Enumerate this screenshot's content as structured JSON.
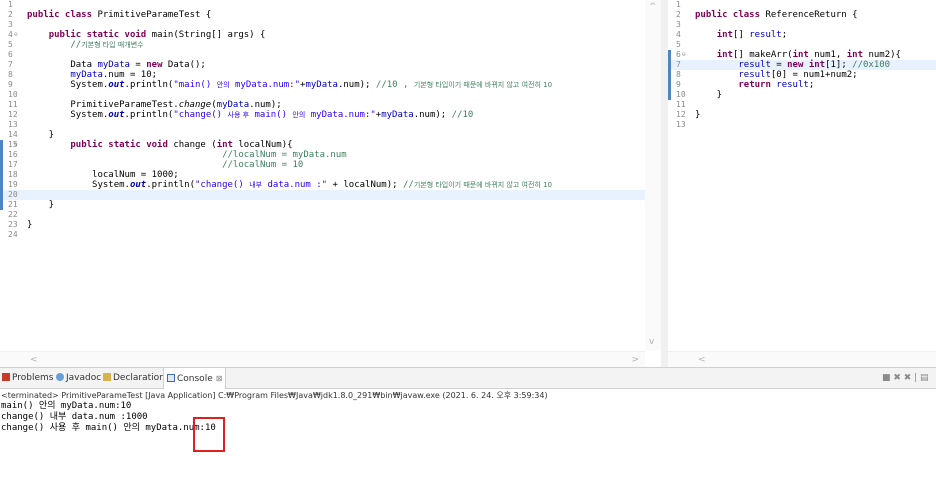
{
  "left_editor": {
    "lines": [
      {
        "n": "1",
        "ann": "",
        "parts": []
      },
      {
        "n": "2",
        "ann": "",
        "parts": [
          {
            "t": "public class",
            "c": "kw"
          },
          {
            "t": " PrimitiveParameTest {",
            "c": ""
          }
        ]
      },
      {
        "n": "3",
        "ann": "",
        "parts": []
      },
      {
        "n": "4",
        "ann": "⊖",
        "parts": [
          {
            "t": "    ",
            "c": ""
          },
          {
            "t": "public static void",
            "c": "kw"
          },
          {
            "t": " main(String[] args) {",
            "c": ""
          }
        ]
      },
      {
        "n": "5",
        "ann": "",
        "parts": [
          {
            "t": "        //",
            "c": "cmt"
          },
          {
            "t": "기본형 타입 매개변수",
            "c": "cmt kr"
          }
        ]
      },
      {
        "n": "6",
        "ann": "",
        "parts": []
      },
      {
        "n": "7",
        "ann": "",
        "parts": [
          {
            "t": "        Data ",
            "c": ""
          },
          {
            "t": "myData",
            "c": "fld"
          },
          {
            "t": " = ",
            "c": ""
          },
          {
            "t": "new",
            "c": "kw"
          },
          {
            "t": " Data();",
            "c": ""
          }
        ]
      },
      {
        "n": "8",
        "ann": "",
        "parts": [
          {
            "t": "        ",
            "c": ""
          },
          {
            "t": "myData",
            "c": "fld"
          },
          {
            "t": ".num = 10;",
            "c": ""
          }
        ]
      },
      {
        "n": "9",
        "ann": "",
        "parts": [
          {
            "t": "        System.",
            "c": ""
          },
          {
            "t": "out",
            "c": "st"
          },
          {
            "t": ".println(",
            "c": ""
          },
          {
            "t": "\"main() ",
            "c": "str"
          },
          {
            "t": "안의",
            "c": "str kr"
          },
          {
            "t": " myData.num:\"",
            "c": "str"
          },
          {
            "t": "+",
            "c": ""
          },
          {
            "t": "myData",
            "c": "fld"
          },
          {
            "t": ".num); ",
            "c": ""
          },
          {
            "t": "//10 , ",
            "c": "cmt"
          },
          {
            "t": "기본형 타입이기 때문에 바뀌지 않고 여전히 10",
            "c": "cmt kr"
          }
        ]
      },
      {
        "n": "10",
        "ann": "",
        "parts": []
      },
      {
        "n": "11",
        "ann": "",
        "parts": [
          {
            "t": "        PrimitiveParameTest.",
            "c": ""
          },
          {
            "t": "change",
            "c": "ital"
          },
          {
            "t": "(",
            "c": ""
          },
          {
            "t": "myData",
            "c": "fld"
          },
          {
            "t": ".num);",
            "c": ""
          }
        ]
      },
      {
        "n": "12",
        "ann": "",
        "parts": [
          {
            "t": "        System.",
            "c": ""
          },
          {
            "t": "out",
            "c": "st"
          },
          {
            "t": ".println(",
            "c": ""
          },
          {
            "t": "\"change() ",
            "c": "str"
          },
          {
            "t": "사용 후",
            "c": "str kr"
          },
          {
            "t": " main() ",
            "c": "str"
          },
          {
            "t": "안의",
            "c": "str kr"
          },
          {
            "t": " myData.num:\"",
            "c": "str"
          },
          {
            "t": "+",
            "c": ""
          },
          {
            "t": "myData",
            "c": "fld"
          },
          {
            "t": ".num); ",
            "c": ""
          },
          {
            "t": "//10",
            "c": "cmt"
          }
        ]
      },
      {
        "n": "13",
        "ann": "",
        "parts": []
      },
      {
        "n": "14",
        "ann": "",
        "parts": [
          {
            "t": "    }",
            "c": ""
          }
        ]
      },
      {
        "n": "15",
        "ann": "⊖",
        "marker": true,
        "parts": [
          {
            "t": "        ",
            "c": ""
          },
          {
            "t": "public static void",
            "c": "kw"
          },
          {
            "t": " change (",
            "c": ""
          },
          {
            "t": "int",
            "c": "kw"
          },
          {
            "t": " localNum){",
            "c": ""
          }
        ]
      },
      {
        "n": "16",
        "ann": "",
        "marker": true,
        "parts": [
          {
            "t": "                                    //localNum = myData.num",
            "c": "cmt"
          }
        ]
      },
      {
        "n": "17",
        "ann": "",
        "marker": true,
        "parts": [
          {
            "t": "                                    //localNum = 10",
            "c": "cmt"
          }
        ]
      },
      {
        "n": "18",
        "ann": "",
        "marker": true,
        "parts": [
          {
            "t": "            localNum = 1000;",
            "c": ""
          }
        ]
      },
      {
        "n": "19",
        "ann": "",
        "marker": true,
        "parts": [
          {
            "t": "            System.",
            "c": ""
          },
          {
            "t": "out",
            "c": "st"
          },
          {
            "t": ".println(",
            "c": ""
          },
          {
            "t": "\"change() ",
            "c": "str"
          },
          {
            "t": "내부",
            "c": "str kr"
          },
          {
            "t": " data.num :\"",
            "c": "str"
          },
          {
            "t": " + localNum); ",
            "c": ""
          },
          {
            "t": "//",
            "c": "cmt"
          },
          {
            "t": "기본형 타입이기 때문에 바뀌지 않고 여전히 10",
            "c": "cmt kr"
          }
        ]
      },
      {
        "n": "20",
        "ann": "",
        "marker": true,
        "current": true,
        "parts": []
      },
      {
        "n": "21",
        "ann": "",
        "marker": true,
        "parts": [
          {
            "t": "    }",
            "c": ""
          }
        ]
      },
      {
        "n": "22",
        "ann": "",
        "parts": []
      },
      {
        "n": "23",
        "ann": "",
        "parts": [
          {
            "t": "}",
            "c": ""
          }
        ]
      },
      {
        "n": "24",
        "ann": "",
        "parts": []
      }
    ]
  },
  "right_editor": {
    "lines": [
      {
        "n": "1",
        "ann": "",
        "parts": []
      },
      {
        "n": "2",
        "ann": "",
        "parts": [
          {
            "t": "public class",
            "c": "kw"
          },
          {
            "t": " ReferenceReturn {",
            "c": ""
          }
        ]
      },
      {
        "n": "3",
        "ann": "",
        "parts": []
      },
      {
        "n": "4",
        "ann": "",
        "parts": [
          {
            "t": "    ",
            "c": ""
          },
          {
            "t": "int",
            "c": "kw"
          },
          {
            "t": "[] ",
            "c": ""
          },
          {
            "t": "result",
            "c": "fld"
          },
          {
            "t": ";",
            "c": ""
          }
        ]
      },
      {
        "n": "5",
        "ann": "",
        "parts": []
      },
      {
        "n": "6",
        "ann": "⊖",
        "marker": true,
        "parts": [
          {
            "t": "    ",
            "c": ""
          },
          {
            "t": "int",
            "c": "kw"
          },
          {
            "t": "[] makeArr(",
            "c": ""
          },
          {
            "t": "int",
            "c": "kw"
          },
          {
            "t": " num1, ",
            "c": ""
          },
          {
            "t": "int",
            "c": "kw"
          },
          {
            "t": " num2){",
            "c": ""
          }
        ]
      },
      {
        "n": "7",
        "ann": "",
        "marker": true,
        "current": true,
        "parts": [
          {
            "t": "        ",
            "c": ""
          },
          {
            "t": "result",
            "c": "fld"
          },
          {
            "t": " = ",
            "c": ""
          },
          {
            "t": "new int",
            "c": "kw"
          },
          {
            "t": "[1]; ",
            "c": ""
          },
          {
            "t": "//0x100",
            "c": "cmt"
          }
        ]
      },
      {
        "n": "8",
        "ann": "",
        "marker": true,
        "parts": [
          {
            "t": "        ",
            "c": ""
          },
          {
            "t": "result",
            "c": "fld"
          },
          {
            "t": "[0] = num1+num2;",
            "c": ""
          }
        ]
      },
      {
        "n": "9",
        "ann": "",
        "marker": true,
        "parts": [
          {
            "t": "        ",
            "c": ""
          },
          {
            "t": "return",
            "c": "kw"
          },
          {
            "t": " ",
            "c": ""
          },
          {
            "t": "result",
            "c": "fld"
          },
          {
            "t": ";",
            "c": ""
          }
        ]
      },
      {
        "n": "10",
        "ann": "",
        "marker": true,
        "parts": [
          {
            "t": "    }",
            "c": ""
          }
        ]
      },
      {
        "n": "11",
        "ann": "",
        "parts": []
      },
      {
        "n": "12",
        "ann": "",
        "parts": [
          {
            "t": "}",
            "c": ""
          }
        ]
      },
      {
        "n": "13",
        "ann": "",
        "parts": []
      }
    ]
  },
  "scroll_glyphs": {
    "up": "^",
    "down": "v",
    "left": "<",
    "right": ">"
  },
  "console_tabs": {
    "problems": "Problems",
    "javadoc": "Javadoc",
    "declaration": "Declaration",
    "console": "Console",
    "close_glyph": "⊠",
    "toolbar_glyphs": "■ ✖ ✖ | ▤"
  },
  "console": {
    "status": "<terminated> PrimitiveParameTest [Java Application] C:₩Program Files₩Java₩jdk1.8.0_291₩bin₩javaw.exe (2021. 6. 24. 오후 3:59:34)",
    "output": [
      "main() 안의 myData.num:10",
      "change() 내부 data.num :1000",
      "change() 사용 후 main() 안의 myData.num:10"
    ]
  },
  "colors": {
    "keyword": "#7f0055",
    "field": "#0000c0",
    "string": "#2a00ff",
    "comment": "#3f7f5f",
    "highlight_box": "#e0201d",
    "current_line": "#e8f2fe"
  }
}
